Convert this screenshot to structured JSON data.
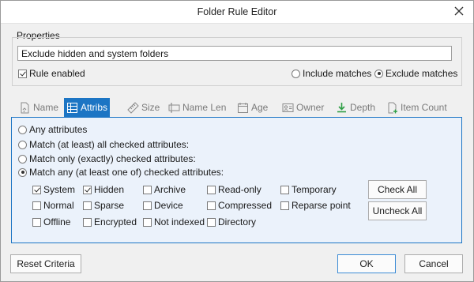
{
  "window": {
    "title": "Folder Rule Editor"
  },
  "properties": {
    "label": "Properties",
    "name_value": "Exclude hidden and system folders",
    "rule_enabled_label": "Rule enabled",
    "rule_enabled": true,
    "include_label": "Include matches",
    "exclude_label": "Exclude matches",
    "selected_mode": "exclude"
  },
  "tabs": [
    {
      "label": "Name",
      "icon": "name-doc-icon"
    },
    {
      "label": "Attribs",
      "icon": "attribs-grid-icon",
      "active": true
    },
    {
      "label": "Size",
      "icon": "ruler-icon"
    },
    {
      "label": "Name Len",
      "icon": "name-length-icon"
    },
    {
      "label": "Age",
      "icon": "calendar-icon"
    },
    {
      "label": "Owner",
      "icon": "owner-card-icon"
    },
    {
      "label": "Depth",
      "icon": "depth-down-icon"
    },
    {
      "label": "Item Count",
      "icon": "item-count-icon"
    }
  ],
  "attribs": {
    "options": [
      "Any attributes",
      "Match (at least) all checked attributes:",
      "Match only (exactly) checked attributes:",
      "Match any (at least one of) checked attributes:"
    ],
    "selected_option": 3,
    "checkboxes": [
      [
        {
          "label": "System",
          "checked": true
        },
        {
          "label": "Hidden",
          "checked": true
        },
        {
          "label": "Archive",
          "checked": false
        },
        {
          "label": "Read-only",
          "checked": false
        },
        {
          "label": "Temporary",
          "checked": false
        }
      ],
      [
        {
          "label": "Normal",
          "checked": false
        },
        {
          "label": "Sparse",
          "checked": false
        },
        {
          "label": "Device",
          "checked": false
        },
        {
          "label": "Compressed",
          "checked": false
        },
        {
          "label": "Reparse point",
          "checked": false
        }
      ],
      [
        {
          "label": "Offline",
          "checked": false
        },
        {
          "label": "Encrypted",
          "checked": false
        },
        {
          "label": "Not indexed",
          "checked": false
        },
        {
          "label": "Directory",
          "checked": false
        }
      ]
    ],
    "check_all_label": "Check All",
    "uncheck_all_label": "Uncheck All"
  },
  "footer": {
    "reset_label": "Reset Criteria",
    "ok_label": "OK",
    "cancel_label": "Cancel"
  },
  "colors": {
    "accent": "#1c75c4",
    "panel_bg": "#ebf2fb",
    "dialog_bg": "#f0f0f0"
  }
}
